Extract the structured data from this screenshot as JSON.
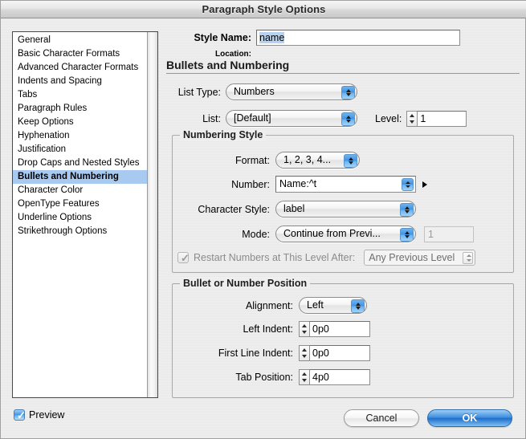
{
  "window": {
    "title": "Paragraph Style Options"
  },
  "sidebar": {
    "items": [
      {
        "label": "General",
        "selected": false
      },
      {
        "label": "Basic Character Formats",
        "selected": false
      },
      {
        "label": "Advanced Character Formats",
        "selected": false
      },
      {
        "label": "Indents and Spacing",
        "selected": false
      },
      {
        "label": "Tabs",
        "selected": false
      },
      {
        "label": "Paragraph Rules",
        "selected": false
      },
      {
        "label": "Keep Options",
        "selected": false
      },
      {
        "label": "Hyphenation",
        "selected": false
      },
      {
        "label": "Justification",
        "selected": false
      },
      {
        "label": "Drop Caps and Nested Styles",
        "selected": false
      },
      {
        "label": "Bullets and Numbering",
        "selected": true
      },
      {
        "label": "Character Color",
        "selected": false
      },
      {
        "label": "OpenType Features",
        "selected": false
      },
      {
        "label": "Underline Options",
        "selected": false
      },
      {
        "label": "Strikethrough Options",
        "selected": false
      }
    ]
  },
  "header": {
    "style_name_label": "Style Name:",
    "style_name_value": "name",
    "location_label": "Location:",
    "location_value": "",
    "section_title": "Bullets and Numbering"
  },
  "top_controls": {
    "list_type_label": "List Type:",
    "list_type_value": "Numbers",
    "list_label": "List:",
    "list_value": "[Default]",
    "level_label": "Level:",
    "level_value": "1"
  },
  "numbering_style": {
    "group_title": "Numbering Style",
    "format_label": "Format:",
    "format_value": "1, 2, 3, 4...",
    "number_label": "Number:",
    "number_value": "Name:^t",
    "character_style_label": "Character Style:",
    "character_style_value": "label",
    "mode_label": "Mode:",
    "mode_value": "Continue from Previ...",
    "mode_number_value": "1",
    "restart_label": "Restart Numbers at This Level After:",
    "restart_checked": true,
    "restart_value": "Any Previous Level"
  },
  "position": {
    "group_title": "Bullet or Number Position",
    "alignment_label": "Alignment:",
    "alignment_value": "Left",
    "left_indent_label": "Left Indent:",
    "left_indent_value": "0p0",
    "first_line_indent_label": "First Line Indent:",
    "first_line_indent_value": "0p0",
    "tab_position_label": "Tab Position:",
    "tab_position_value": "4p0"
  },
  "footer": {
    "preview_label": "Preview",
    "preview_checked": true,
    "cancel_label": "Cancel",
    "ok_label": "OK"
  },
  "colors": {
    "selection_blue": "#a8c9f0",
    "text_selection": "#b6d2f0",
    "aqua_blue": "#3f92e4",
    "window_bg": "#ededed"
  }
}
